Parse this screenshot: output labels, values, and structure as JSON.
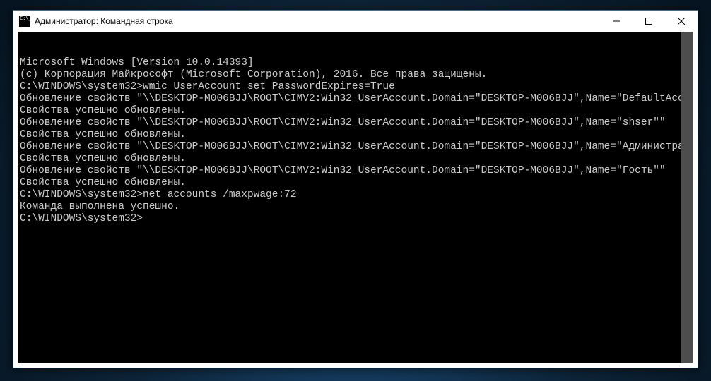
{
  "window": {
    "title": "Администратор: Командная строка"
  },
  "terminal": {
    "header1": "Microsoft Windows [Version 10.0.14393]",
    "header2": "(с) Корпорация Майкрософт (Microsoft Corporation), 2016. Все права защищены.",
    "blank": "",
    "p1_prompt": "C:\\WINDOWS\\system32>wmic UserAccount set PasswordExpires=True",
    "r1": "Обновление свойств \"\\\\DESKTOP-M006BJJ\\ROOT\\CIMV2:Win32_UserAccount.Domain=\"DESKTOP-M006BJJ\",Name=\"DefaultAccount\"\"",
    "r2": "Свойства успешно обновлены.",
    "r3": "Обновление свойств \"\\\\DESKTOP-M006BJJ\\ROOT\\CIMV2:Win32_UserAccount.Domain=\"DESKTOP-M006BJJ\",Name=\"shser\"\"",
    "r4": "Свойства успешно обновлены.",
    "r5": "Обновление свойств \"\\\\DESKTOP-M006BJJ\\ROOT\\CIMV2:Win32_UserAccount.Domain=\"DESKTOP-M006BJJ\",Name=\"Администратор\"\"",
    "r6": "Свойства успешно обновлены.",
    "r7": "Обновление свойств \"\\\\DESKTOP-M006BJJ\\ROOT\\CIMV2:Win32_UserAccount.Domain=\"DESKTOP-M006BJJ\",Name=\"Гость\"\"",
    "r8": "Свойства успешно обновлены.",
    "p2_prompt": "C:\\WINDOWS\\system32>net accounts /maxpwage:72",
    "p2_result": "Команда выполнена успешно.",
    "p3_prompt": "C:\\WINDOWS\\system32>"
  },
  "controls": {
    "minimize": "—",
    "maximize": "☐",
    "close": "✕"
  }
}
